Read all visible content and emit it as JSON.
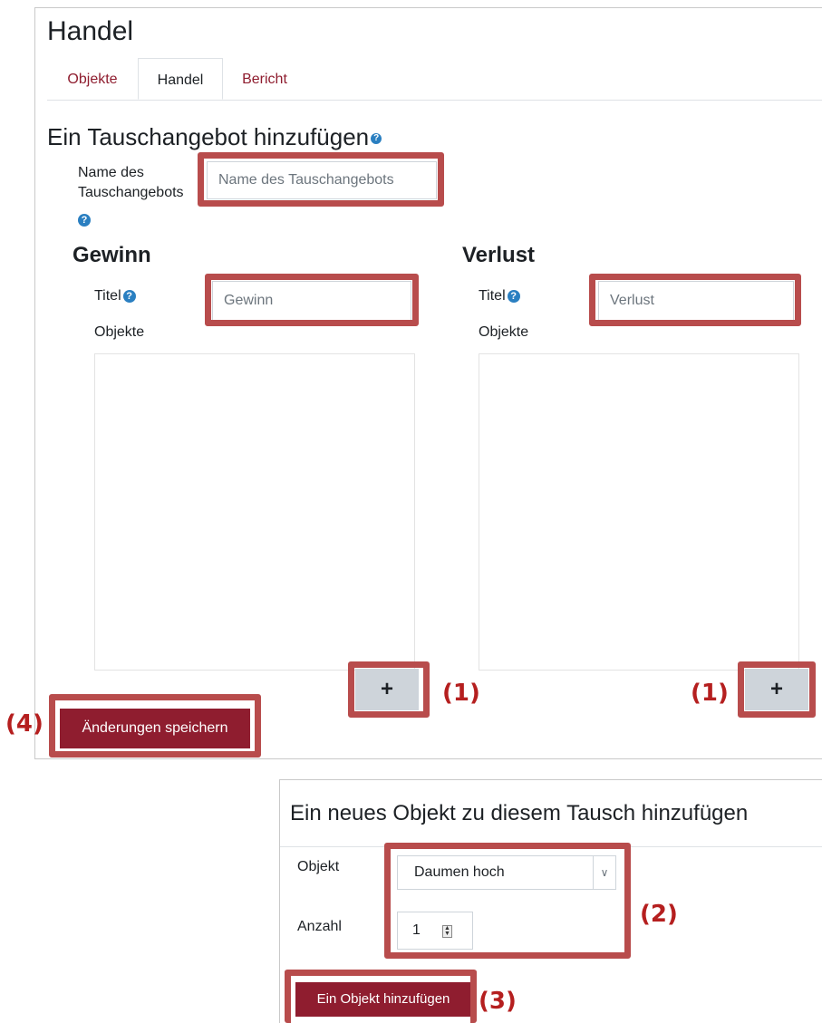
{
  "page": {
    "title": "Handel"
  },
  "tabs": [
    {
      "label": "Objekte",
      "active": false
    },
    {
      "label": "Handel",
      "active": true
    },
    {
      "label": "Bericht",
      "active": false
    }
  ],
  "form": {
    "section_title": "Ein Tauschangebot hinzufügen",
    "name_label_line1": "Name des",
    "name_label_line2": "Tauschangebots",
    "name_placeholder": "Name des Tauschangebots",
    "help_glyph": "?"
  },
  "gain": {
    "heading": "Gewinn",
    "title_label": "Titel",
    "title_placeholder": "Gewinn",
    "objects_label": "Objekte",
    "add_label": "+"
  },
  "loss": {
    "heading": "Verlust",
    "title_label": "Titel",
    "title_placeholder": "Verlust",
    "objects_label": "Objekte",
    "add_label": "+"
  },
  "save_button": "Änderungen speichern",
  "modal": {
    "title": "Ein neues Objekt zu diesem Tausch hinzufügen",
    "object_label": "Objekt",
    "object_value": "Daumen hoch",
    "count_label": "Anzahl",
    "count_value": "1",
    "add_button": "Ein Objekt hinzufügen"
  },
  "markers": {
    "m1": "(1)",
    "m2": "(2)",
    "m3": "(3)",
    "m4": "(4)"
  },
  "colors": {
    "highlight": "#b84c4c",
    "brand": "#8f1d2f",
    "marker": "#b51f1f",
    "help_icon": "#2a7fc1"
  }
}
